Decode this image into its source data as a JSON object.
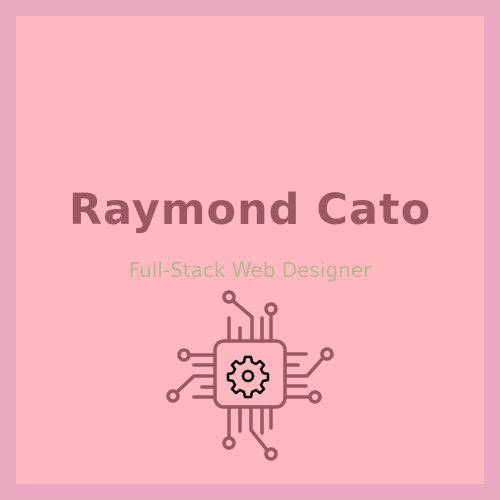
{
  "name": "Raymond Cato",
  "tagline": "Full-Stack Web Designer",
  "icon": "chip-gear-icon",
  "colors": {
    "border": "#eba9c2",
    "background": "#ffb7c0",
    "name": "#9c5860",
    "tagline": "#b8b68f",
    "icon": "#9c5860"
  }
}
